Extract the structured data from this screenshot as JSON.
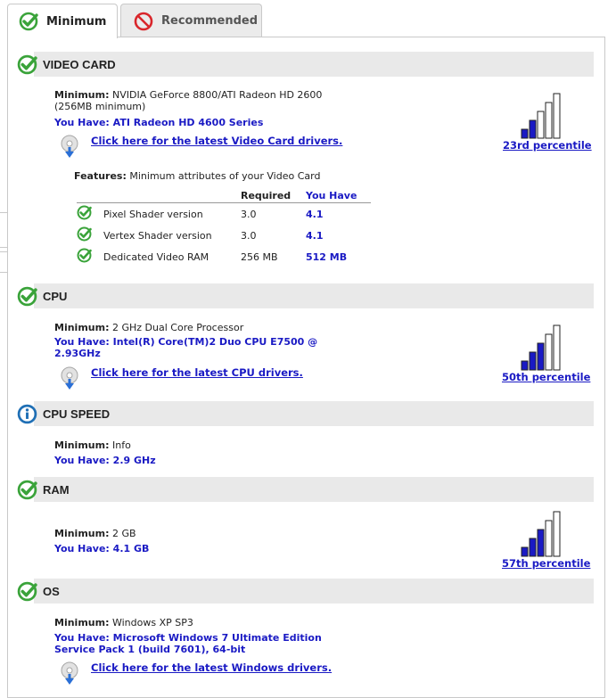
{
  "tabs": [
    {
      "label": "Minimum",
      "icon": "check-circle-icon",
      "active": true
    },
    {
      "label": "Recommended",
      "icon": "prohibited-icon",
      "active": false
    }
  ],
  "colors": {
    "pass": "#3aa33a",
    "fail": "#d9262b",
    "info": "#1f6fb5",
    "link": "#1a1ac4",
    "bar_fill": "#1a1ac4"
  },
  "sections": {
    "video": {
      "title": "VIDEO CARD",
      "status_icon": "check-circle-icon",
      "min_label": "Minimum:",
      "min_value": "NVIDIA GeForce 8800/ATI Radeon HD 2600",
      "min_value2": "(256MB minimum)",
      "have": "You Have: ATI Radeon HD 4600 Series",
      "driver_link": "Click here for the latest Video Card drivers.",
      "percentile": "23rd percentile",
      "bars_filled": 2,
      "features_label": "Features:",
      "features_desc": "Minimum attributes of your Video Card",
      "table_headers": [
        "Required",
        "You Have"
      ],
      "features": [
        {
          "name": "Pixel Shader version",
          "required": "3.0",
          "have": "4.1"
        },
        {
          "name": "Vertex Shader version",
          "required": "3.0",
          "have": "4.1"
        },
        {
          "name": "Dedicated Video RAM",
          "required": "256 MB",
          "have": "512 MB"
        }
      ]
    },
    "cpu": {
      "title": "CPU",
      "status_icon": "check-circle-icon",
      "min_label": "Minimum:",
      "min_value": "2 GHz Dual Core Processor",
      "have": "You Have: Intel(R) Core(TM)2 Duo CPU E7500 @",
      "have2": "2.93GHz",
      "driver_link": "Click here for the latest CPU drivers.",
      "percentile": "50th percentile",
      "bars_filled": 3
    },
    "cpu_speed": {
      "title": "CPU SPEED",
      "status_icon": "info-icon",
      "min_label": "Minimum:",
      "min_value": "Info",
      "have": "You Have: 2.9 GHz"
    },
    "ram": {
      "title": "RAM",
      "status_icon": "check-circle-icon",
      "min_label": "Minimum:",
      "min_value": "2 GB",
      "have": "You Have: 4.1 GB",
      "percentile": "57th percentile",
      "bars_filled": 3
    },
    "os": {
      "title": "OS",
      "status_icon": "check-circle-icon",
      "min_label": "Minimum:",
      "min_value": "Windows XP SP3",
      "have": "You Have: Microsoft Windows 7 Ultimate Edition",
      "have2": "Service Pack 1 (build 7601), 64-bit",
      "driver_link": "Click here for the latest Windows drivers."
    }
  }
}
